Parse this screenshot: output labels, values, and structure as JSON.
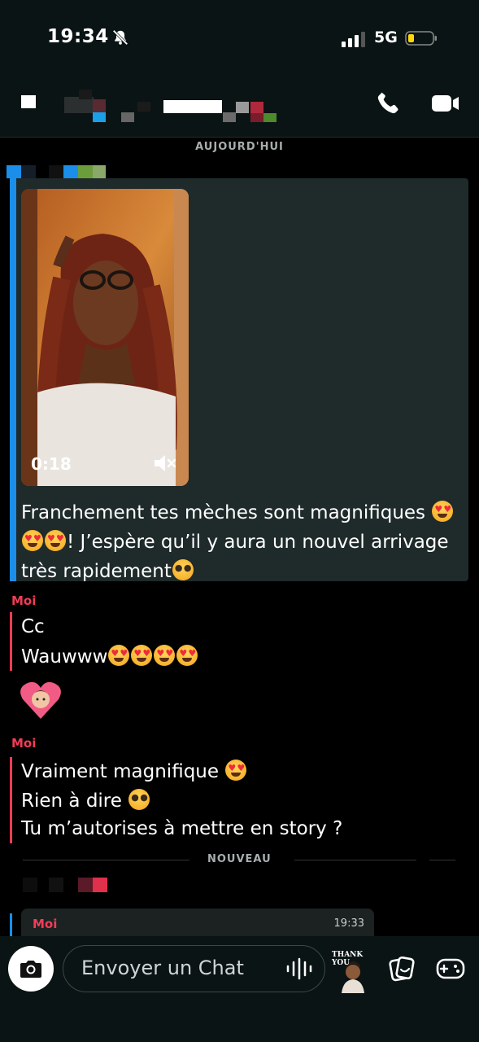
{
  "status_bar": {
    "time": "19:34",
    "network": "5G"
  },
  "chat": {
    "date_separator": "AUJOURD'HUI",
    "media_message": {
      "duration": "0:18",
      "caption_line1": "Franchement tes mèches sont magnifiques",
      "caption_line2": "! J’espère qu’il y aura un nouvel arrivage",
      "caption_line3": "très rapidement"
    },
    "my_messages_1": {
      "sender": "Moi",
      "line1": "Cc",
      "line2": "Wauwww"
    },
    "my_messages_2": {
      "sender": "Moi",
      "line1": "Vraiment magnifique",
      "line2": "Rien à dire",
      "line3": "Tu m’autorises à mettre en story ?"
    },
    "new_separator": "NOUVEAU",
    "reply_preview": {
      "sender": "Moi",
      "time": "19:33"
    }
  },
  "composer": {
    "placeholder": "Envoyer un Chat",
    "sticker_label": "THANK YOU"
  },
  "colors": {
    "accent_blue": "#1a8ee8",
    "me_red": "#f23c57",
    "bar_bg": "#0b1414"
  }
}
